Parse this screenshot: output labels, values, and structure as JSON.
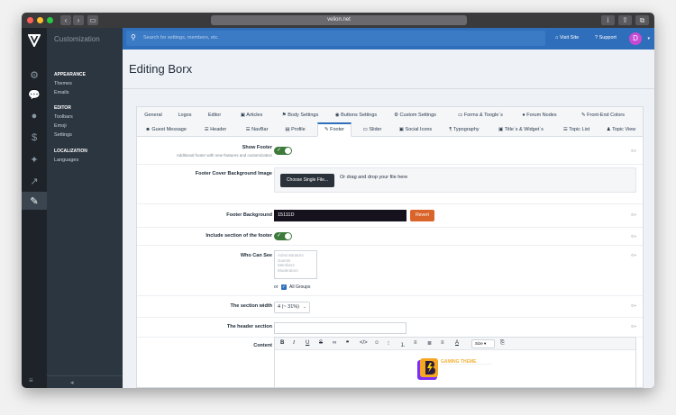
{
  "browser": {
    "url": "velion.net",
    "colors": {
      "close": "#fe5f57",
      "minimize": "#febc2e",
      "maximize": "#28c840"
    }
  },
  "rail": {
    "icons": [
      "palette-icon",
      "chat-bubbles-icon",
      "user-icon",
      "dollar-icon",
      "puzzle-icon",
      "chart-icon",
      "brush-icon"
    ],
    "active": "brush-icon"
  },
  "sidebar": {
    "title": "Customization",
    "sections": [
      {
        "heading": "APPEARANCE",
        "items": [
          "Themes",
          "Emails"
        ]
      },
      {
        "heading": "EDITOR",
        "items": [
          "Toolbars",
          "Emoji",
          "Settings"
        ]
      },
      {
        "heading": "LOCALIZATION",
        "items": [
          "Languages"
        ]
      }
    ]
  },
  "header": {
    "search_placeholder": "Search for settings, members, etc.",
    "visit_site": "Visit Site",
    "support": "Support",
    "avatar_letter": "D",
    "brand_color": "#2f6eba"
  },
  "page": {
    "title": "Editing Borx"
  },
  "tabs": {
    "row1": [
      "General",
      "Logos",
      "Editor",
      "Articles",
      "Body Settings",
      "Buttons Settings",
      "Custom Settings",
      "Forms & Toogle`s",
      "Forum Nodes",
      "Front-End Colors"
    ],
    "row2": [
      "Guest Message",
      "Header",
      "NavBar",
      "Profile",
      "Footer",
      "Slider",
      "Social Icons",
      "Typography",
      "Title`s & Widget`s",
      "Topic List",
      "Topic View"
    ],
    "active": "Footer"
  },
  "form": {
    "show_footer": {
      "label": "Show Footer",
      "sublabel": "Additional footer with new features and customization",
      "on": true
    },
    "cover_bg": {
      "label": "Footer Cover Background Image",
      "button": "Choose Single File...",
      "drop_text": "Or drag and drop your file here"
    },
    "footer_bg": {
      "label": "Footer Background",
      "value": "15111D",
      "revert": "Revert",
      "color": "#15111d"
    },
    "include_section": {
      "label": "Include section of the footer",
      "on": true
    },
    "who_can_see": {
      "label": "Who Can See",
      "options": [
        "Administrators",
        "Guests",
        "Members",
        "Moderators"
      ],
      "or": "or",
      "all_groups": "All Groups",
      "all_checked": true
    },
    "section_width": {
      "label": "The section width",
      "value": "4 (~ 31%)"
    },
    "header_section": {
      "label": "The header section",
      "value": ""
    },
    "content": {
      "label": "Content",
      "size_label": "Size",
      "logo_text": "GAMING THEME"
    }
  }
}
